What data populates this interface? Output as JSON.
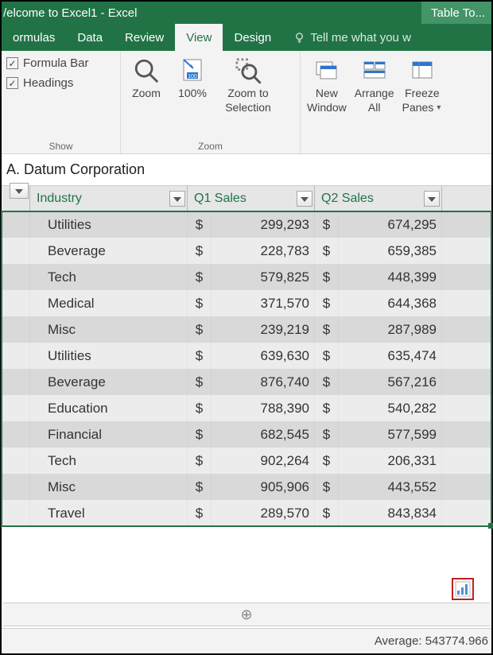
{
  "title": "/elcome to Excel1 - Excel",
  "contextual_tab": "Table To...",
  "tabs": [
    "ormulas",
    "Data",
    "Review",
    "View",
    "Design"
  ],
  "active_tab_index": 3,
  "tellme_placeholder": "Tell me what you w",
  "ribbon": {
    "show": {
      "formula_bar": "Formula Bar",
      "headings": "Headings",
      "group_label": "Show"
    },
    "zoom": {
      "zoom": "Zoom",
      "hundred": "100%",
      "zoom_selection_l1": "Zoom to",
      "zoom_selection_l2": "Selection",
      "group_label": "Zoom"
    },
    "window": {
      "new_window_l1": "New",
      "new_window_l2": "Window",
      "arrange_l1": "Arrange",
      "arrange_l2": "All",
      "freeze_l1": "Freeze",
      "freeze_l2": "Panes"
    }
  },
  "formula_cell": "A. Datum Corporation",
  "columns": {
    "industry": "Industry",
    "q1": "Q1 Sales",
    "q2": "Q2 Sales"
  },
  "currency": "$",
  "chart_data": {
    "type": "table",
    "columns": [
      "Industry",
      "Q1 Sales",
      "Q2 Sales"
    ],
    "rows": [
      {
        "industry": "Utilities",
        "q1": 299293,
        "q2": 674295
      },
      {
        "industry": "Beverage",
        "q1": 228783,
        "q2": 659385
      },
      {
        "industry": "Tech",
        "q1": 579825,
        "q2": 448399
      },
      {
        "industry": "Medical",
        "q1": 371570,
        "q2": 644368
      },
      {
        "industry": "Misc",
        "q1": 239219,
        "q2": 287989
      },
      {
        "industry": "Utilities",
        "q1": 639630,
        "q2": 635474
      },
      {
        "industry": "Beverage",
        "q1": 876740,
        "q2": 567216
      },
      {
        "industry": "Education",
        "q1": 788390,
        "q2": 540282
      },
      {
        "industry": "Financial",
        "q1": 682545,
        "q2": 577599
      },
      {
        "industry": "Tech",
        "q1": 902264,
        "q2": 206331
      },
      {
        "industry": "Misc",
        "q1": 905906,
        "q2": 443552
      },
      {
        "industry": "Travel",
        "q1": 289570,
        "q2": 843834
      }
    ]
  },
  "status": "Average: 543774.966"
}
